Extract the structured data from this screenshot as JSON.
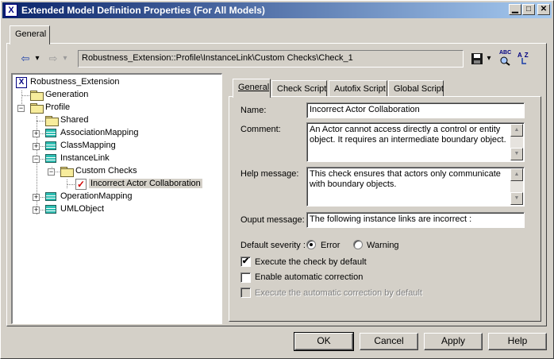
{
  "window": {
    "title": "Extended Model Definition Properties (For All Models)",
    "controls": {
      "minimize": "▁",
      "maximize": "□",
      "close": "✕"
    }
  },
  "outer_tabs": [
    {
      "label": "General"
    }
  ],
  "toolbar": {
    "back_icon": "⇦",
    "back_dropdown": "▾",
    "forward_icon": "⇨",
    "forward_dropdown": "▾",
    "path": "Robustness_Extension::Profile\\InstanceLink\\Custom Checks\\Check_1",
    "save_icon": "floppy-disk-icon",
    "save_dropdown": "▾",
    "spell_check_icon": "ABC",
    "sort_icon": "AZ"
  },
  "tree": {
    "root": "Robustness_Extension",
    "generation": "Generation",
    "profile": "Profile",
    "shared": "Shared",
    "association_mapping": "AssociationMapping",
    "class_mapping": "ClassMapping",
    "instance_link": "InstanceLink",
    "custom_checks": "Custom Checks",
    "selected_check": "Incorrect Actor Collaboration",
    "operation_mapping": "OperationMapping",
    "uml_object": "UMLObject"
  },
  "inner_tabs": [
    {
      "label": "General"
    },
    {
      "label": "Check Script"
    },
    {
      "label": "Autofix Script"
    },
    {
      "label": "Global Script"
    }
  ],
  "form": {
    "name_label": "Name:",
    "name_value": "Incorrect Actor Collaboration",
    "comment_label": "Comment:",
    "comment_value": "An Actor cannot access directly a control or entity object. It requires an intermediate boundary object.",
    "help_label": "Help message:",
    "help_value": "This check ensures that actors only communicate with boundary objects.",
    "output_label": "Ouput message:",
    "output_value": "The following instance links are incorrect :",
    "severity_label": "Default severity :",
    "severity_error": "Error",
    "severity_warning": "Warning",
    "severity_selected": "Error",
    "execute_default_label": "Execute the check by default",
    "execute_default_checked": true,
    "enable_auto_label": "Enable automatic correction",
    "enable_auto_checked": false,
    "execute_auto_label": "Execute the automatic correction by default",
    "execute_auto_checked": false,
    "checkmark": "✔"
  },
  "buttons": {
    "ok": "OK",
    "cancel": "Cancel",
    "apply": "Apply",
    "help": "Help"
  }
}
